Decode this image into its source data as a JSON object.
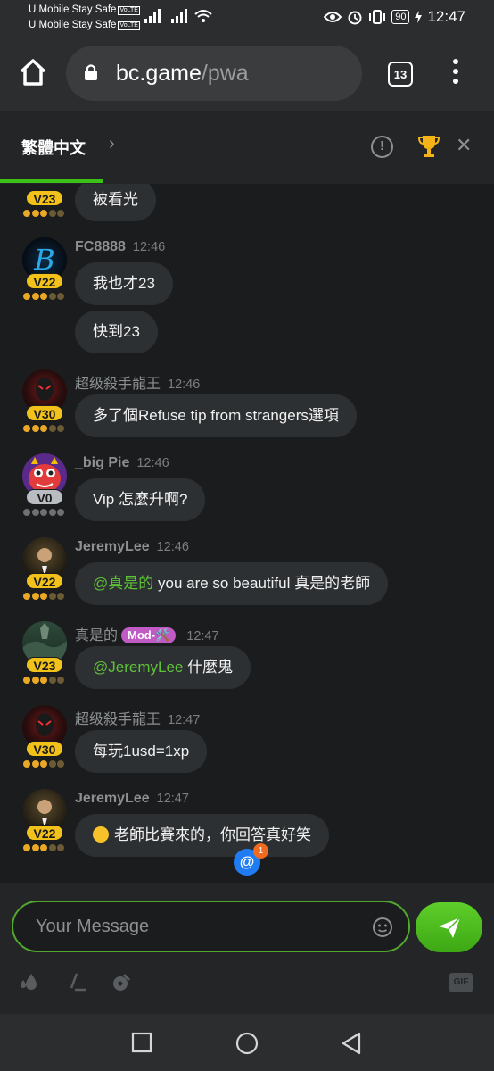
{
  "status_bar": {
    "carrier1": "U Mobile Stay Safe",
    "carrier2": "U Mobile Stay Safe",
    "volte": "VoLTE",
    "battery": "90",
    "time": "12:47"
  },
  "browser": {
    "domain": "bc.game",
    "path": "/pwa",
    "tab_count": "13"
  },
  "chat_header": {
    "language": "繁體中文",
    "info_glyph": "!",
    "close_glyph": "✕"
  },
  "messages": [
    {
      "user": "",
      "time": "",
      "level": "V23",
      "bubbles": [
        {
          "text": "被看光"
        }
      ]
    },
    {
      "user": "FC8888",
      "time": "12:46",
      "level": "V22",
      "bubbles": [
        {
          "text": "我也才23"
        },
        {
          "text": "快到23"
        }
      ]
    },
    {
      "user": "超级殺手龍王",
      "time": "12:46",
      "level": "V30",
      "bubbles": [
        {
          "text": "多了個Refuse tip from strangers選項"
        }
      ]
    },
    {
      "user": "_big Pie",
      "time": "12:46",
      "level": "V0",
      "bubbles": [
        {
          "text": "Vip 怎麼升啊?"
        }
      ]
    },
    {
      "user": "JeremyLee",
      "time": "12:46",
      "level": "V22",
      "bubbles": [
        {
          "mention": "@真是的",
          "text": " you are so beautiful 真是的老師"
        }
      ]
    },
    {
      "user": "真是的",
      "tag": "Mod-🛠️",
      "time": "12:47",
      "level": "V23",
      "bubbles": [
        {
          "mention": "@JeremyLee",
          "text": " 什麼鬼"
        }
      ]
    },
    {
      "user": "超级殺手龍王",
      "time": "12:47",
      "level": "V30",
      "bubbles": [
        {
          "text": "每玩1usd=1xp"
        }
      ]
    },
    {
      "user": "JeremyLee",
      "time": "12:47",
      "level": "V22",
      "bubbles": [
        {
          "text": "老師比賽來的，你回答真好笑"
        }
      ]
    }
  ],
  "mention_indicator": {
    "symbol": "@",
    "count": "1"
  },
  "composer": {
    "placeholder": "Your Message",
    "gif_label": "GIF"
  },
  "colors": {
    "accent": "#3bc117",
    "vip_gold": "#f2c21a",
    "mention": "#5fc339",
    "mod_tag": "#c05ac4"
  }
}
